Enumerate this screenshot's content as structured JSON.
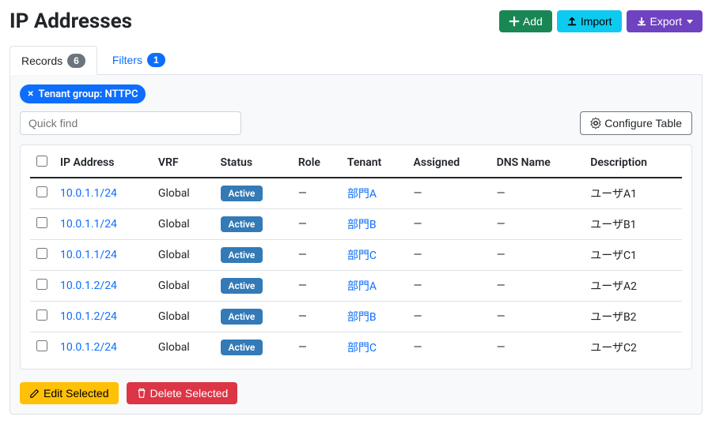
{
  "header": {
    "title": "IP Addresses",
    "add_label": "Add",
    "import_label": "Import",
    "export_label": "Export"
  },
  "tabs": {
    "records_label": "Records",
    "records_count": "6",
    "filters_label": "Filters",
    "filters_count": "1"
  },
  "filter_chip": {
    "label": "Tenant group: NTTPC"
  },
  "toolbar": {
    "quickfind_placeholder": "Quick find",
    "configure_label": "Configure Table"
  },
  "table": {
    "columns": {
      "ip": "IP Address",
      "vrf": "VRF",
      "status": "Status",
      "role": "Role",
      "tenant": "Tenant",
      "assigned": "Assigned",
      "dns": "DNS Name",
      "description": "Description"
    },
    "rows": [
      {
        "ip": "10.0.1.1/24",
        "vrf": "Global",
        "status": "Active",
        "role": "—",
        "tenant": "部門A",
        "assigned": "—",
        "dns": "—",
        "description": "ユーザA1"
      },
      {
        "ip": "10.0.1.1/24",
        "vrf": "Global",
        "status": "Active",
        "role": "—",
        "tenant": "部門B",
        "assigned": "—",
        "dns": "—",
        "description": "ユーザB1"
      },
      {
        "ip": "10.0.1.1/24",
        "vrf": "Global",
        "status": "Active",
        "role": "—",
        "tenant": "部門C",
        "assigned": "—",
        "dns": "—",
        "description": "ユーザC1"
      },
      {
        "ip": "10.0.1.2/24",
        "vrf": "Global",
        "status": "Active",
        "role": "—",
        "tenant": "部門A",
        "assigned": "—",
        "dns": "—",
        "description": "ユーザA2"
      },
      {
        "ip": "10.0.1.2/24",
        "vrf": "Global",
        "status": "Active",
        "role": "—",
        "tenant": "部門B",
        "assigned": "—",
        "dns": "—",
        "description": "ユーザB2"
      },
      {
        "ip": "10.0.1.2/24",
        "vrf": "Global",
        "status": "Active",
        "role": "—",
        "tenant": "部門C",
        "assigned": "—",
        "dns": "—",
        "description": "ユーザC2"
      }
    ]
  },
  "bottom": {
    "edit_label": "Edit Selected",
    "delete_label": "Delete Selected"
  }
}
